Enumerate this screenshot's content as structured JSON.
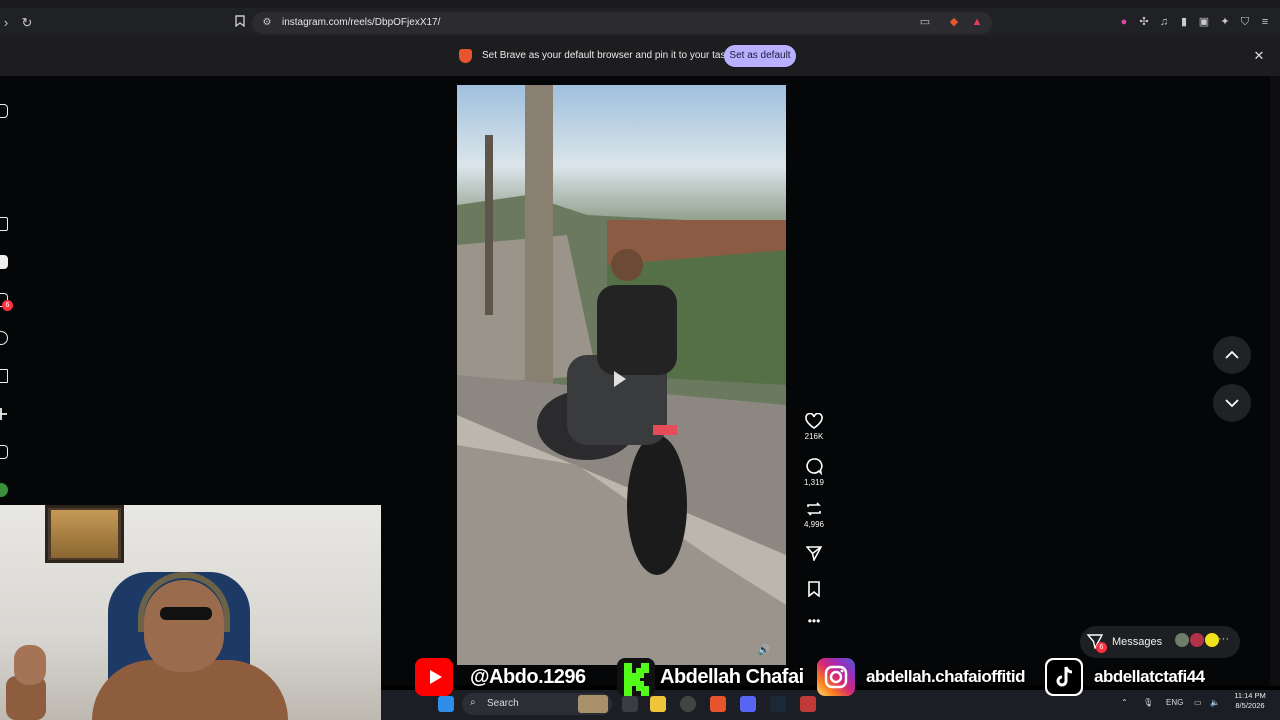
{
  "browser": {
    "url": "instagram.com/reels/DbpOFjexX17/",
    "infobar_message": "Set Brave as your default browser and pin it to your taskbar",
    "set_default_label": "Set as default"
  },
  "sidebar": {
    "notifications_badge": "6"
  },
  "reel": {
    "likes": "216K",
    "comments": "1,319",
    "reposts": "4,996"
  },
  "messages": {
    "label": "Messages",
    "badge": "6"
  },
  "overlay": {
    "youtube_handle": "@Abdo.1296",
    "kick_name": "Abdellah Chafai",
    "instagram_handle": "abdellah.chafaioffitid",
    "tiktok_handle": "abdellatctafi44"
  },
  "taskbar": {
    "search_label": "Search",
    "lang": "ENG",
    "time": "11:14 PM",
    "date": "8/5/2026"
  },
  "colors": {
    "accent_purple": "#b9b1ff",
    "badge_red": "#ff3040",
    "youtube_red": "#ff0000",
    "kick_green": "#53fc18"
  }
}
